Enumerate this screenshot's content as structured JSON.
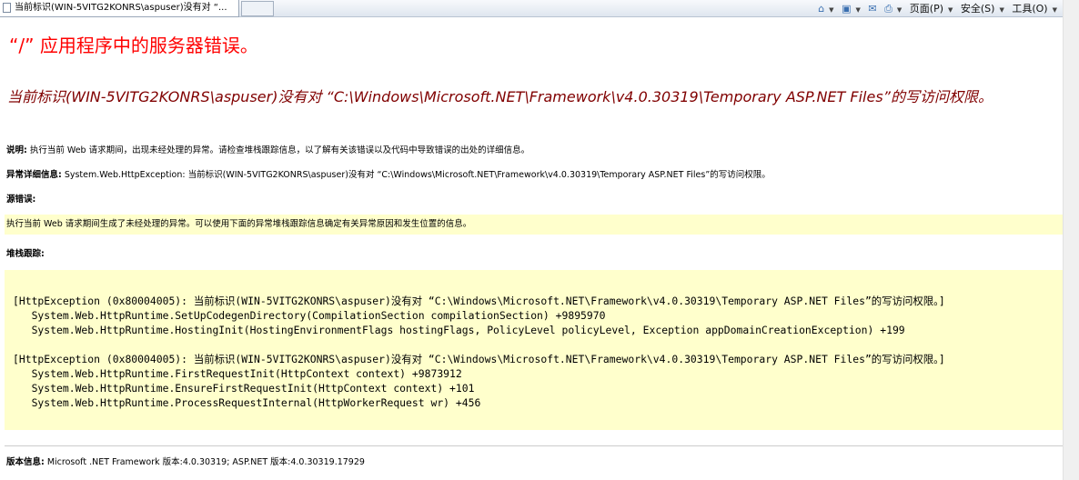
{
  "browser": {
    "tab_title": "当前标识(WIN-5VITG2KONRS\\aspuser)没有对 “...",
    "commands": {
      "page": "页面(P)",
      "safety": "安全(S)",
      "tools": "工具(O)"
    }
  },
  "page": {
    "title": "“/” 应用程序中的服务器错误。",
    "error_heading": "当前标识(WIN-5VITG2KONRS\\aspuser)没有对 “C:\\Windows\\Microsoft.NET\\Framework\\v4.0.30319\\Temporary ASP.NET Files”的写访问权限。",
    "description_label": "说明:",
    "description_text": " 执行当前 Web 请求期间，出现未经处理的异常。请检查堆栈跟踪信息，以了解有关该错误以及代码中导致错误的出处的详细信息。",
    "exception_label": "异常详细信息:",
    "exception_text": " System.Web.HttpException: 当前标识(WIN-5VITG2KONRS\\aspuser)没有对 “C:\\Windows\\Microsoft.NET\\Framework\\v4.0.30319\\Temporary ASP.NET Files”的写访问权限。",
    "source_error_label": "源错误:",
    "source_error_text": "执行当前 Web 请求期间生成了未经处理的异常。可以使用下面的异常堆栈跟踪信息确定有关异常原因和发生位置的信息。",
    "stack_trace_label": "堆栈跟踪:",
    "stack_trace": "[HttpException (0x80004005): 当前标识(WIN-5VITG2KONRS\\aspuser)没有对 “C:\\Windows\\Microsoft.NET\\Framework\\v4.0.30319\\Temporary ASP.NET Files”的写访问权限。]\n   System.Web.HttpRuntime.SetUpCodegenDirectory(CompilationSection compilationSection) +9895970\n   System.Web.HttpRuntime.HostingInit(HostingEnvironmentFlags hostingFlags, PolicyLevel policyLevel, Exception appDomainCreationException) +199\n\n[HttpException (0x80004005): 当前标识(WIN-5VITG2KONRS\\aspuser)没有对 “C:\\Windows\\Microsoft.NET\\Framework\\v4.0.30319\\Temporary ASP.NET Files”的写访问权限。]\n   System.Web.HttpRuntime.FirstRequestInit(HttpContext context) +9873912\n   System.Web.HttpRuntime.EnsureFirstRequestInit(HttpContext context) +101\n   System.Web.HttpRuntime.ProcessRequestInternal(HttpWorkerRequest wr) +456",
    "version_label": "版本信息:",
    "version_text": " Microsoft .NET Framework 版本:4.0.30319; ASP.NET 版本:4.0.30319.17929"
  }
}
